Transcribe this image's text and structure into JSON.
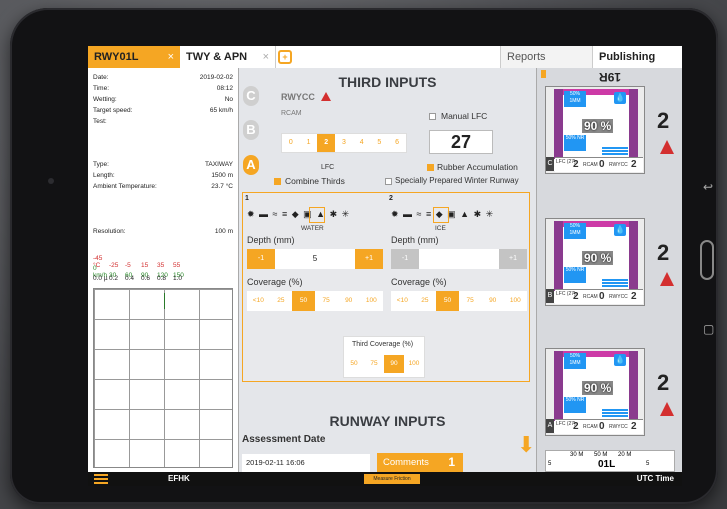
{
  "tabs": {
    "active": "RWY01L",
    "second": "TWY & APN",
    "close_glyph": "×",
    "reports": "Reports",
    "publishing": "Publishing"
  },
  "left_panel": {
    "info": [
      {
        "label": "Date:",
        "value": "2019-02-02"
      },
      {
        "label": "Time:",
        "value": "08:12"
      },
      {
        "label": "Wetting:",
        "value": "No"
      },
      {
        "label": "Target speed:",
        "value": "65 km/h"
      },
      {
        "label": "Test:",
        "value": ""
      },
      {
        "label": "Type:",
        "value": "TAXIWAY"
      },
      {
        "label": "Length:",
        "value": "1500 m"
      },
      {
        "label": "Ambient Temperature:",
        "value": "23.7 °C"
      },
      {
        "label": "Resolution:",
        "value": "100 m"
      }
    ],
    "legend_red": [
      "-45 °C",
      "-25",
      "-5",
      "15",
      "35",
      "55"
    ],
    "legend_green": [
      "0 km/h",
      "30",
      "60",
      "90",
      "120",
      "150"
    ],
    "legend_black": [
      "0.0 µ",
      "0.2",
      "0.4",
      "0.6",
      "0.8",
      "1.0"
    ]
  },
  "third_inputs": {
    "heading": "THIRD INPUTS",
    "letters": [
      "C",
      "B",
      "A"
    ],
    "rwycc_label": "RWYCC",
    "rcam_label": "RCAM",
    "lfc_label": "LFC",
    "scale": [
      "0",
      "1",
      "2",
      "3",
      "4",
      "5",
      "6"
    ],
    "scale_selected": "2",
    "manual_lfc_label": "Manual LFC",
    "manual_lfc_value": "27",
    "rubber_label": "Rubber Accumulation",
    "combine_label": "Combine Thirds",
    "special_label": "Specially Prepared Winter Runway"
  },
  "third_1": {
    "number": "1",
    "condition": "WATER",
    "depth_label": "Depth (mm)",
    "minus": "-1",
    "plus": "+1",
    "depth_value": "5",
    "coverage_label": "Coverage (%)",
    "coverage_options": [
      "<10",
      "25",
      "50",
      "75",
      "90",
      "100"
    ],
    "coverage_selected": "50"
  },
  "third_2": {
    "number": "2",
    "condition": "ICE",
    "depth_label": "Depth (mm)",
    "minus": "-1",
    "plus": "+1",
    "depth_value": "",
    "coverage_label": "Coverage (%)",
    "coverage_options": [
      "<10",
      "25",
      "50",
      "75",
      "90",
      "100"
    ],
    "coverage_selected": "50"
  },
  "third_coverage": {
    "label": "Third Coverage (%)",
    "options": [
      "50",
      "75",
      "90",
      "100"
    ],
    "selected": "90"
  },
  "runway_inputs": {
    "heading": "RUNWAY INPUTS",
    "assessment_label": "Assessment Date",
    "assessment_value": "2019-02-11 16:06",
    "comments_label": "Comments",
    "comments_count": "1"
  },
  "runway_view": {
    "top_label": "19R",
    "bottom_label": "01L",
    "thirds": [
      {
        "letter": "C",
        "chip_top": "50% 1MM",
        "chip_bottom": "50% NR",
        "pct": "90 %",
        "lfc": "2",
        "rcam": "0",
        "rwycc": "2",
        "code": "2"
      },
      {
        "letter": "B",
        "chip_top": "50% 1MM",
        "chip_bottom": "50% NR",
        "pct": "90 %",
        "lfc": "2",
        "rcam": "0",
        "rwycc": "2",
        "code": "2"
      },
      {
        "letter": "A",
        "chip_top": "50% 1MM",
        "chip_bottom": "50% NR",
        "pct": "90 %",
        "lfc": "2",
        "rcam": "0",
        "rwycc": "2",
        "code": "2"
      }
    ],
    "footer_marks": [
      "30 M",
      "50 M",
      "20 M"
    ],
    "side_num": "5",
    "readout_labels": {
      "lfc": "LFC (27)",
      "rcam": "RCAM",
      "rwycc": "RWYCC"
    }
  },
  "bottom_bar": {
    "airport": "EFHK",
    "measure_label": "Measure Friction",
    "time_label": "UTC Time"
  },
  "colors": {
    "accent": "#f5a623",
    "danger": "#d32f2f",
    "water": "#2196f3",
    "purple": "#8a3a8e"
  }
}
